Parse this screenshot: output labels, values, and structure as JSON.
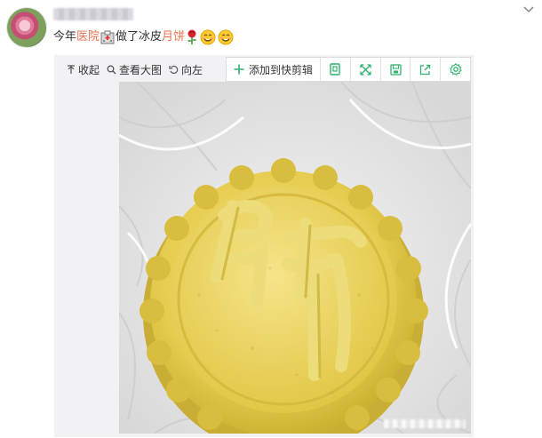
{
  "post": {
    "username": "",
    "text_parts": [
      {
        "type": "text",
        "value": "今年"
      },
      {
        "type": "link",
        "value": "医院"
      },
      {
        "type": "emoji",
        "name": "hospital-emoji"
      },
      {
        "type": "text",
        "value": "做了冰皮"
      },
      {
        "type": "link",
        "value": "月饼"
      },
      {
        "type": "emoji",
        "name": "rose-emoji"
      },
      {
        "type": "emoji",
        "name": "smiley-emoji"
      },
      {
        "type": "emoji",
        "name": "smiley-emoji"
      }
    ]
  },
  "toolbar": {
    "collapse_label": "收起",
    "view_large_label": "查看大图",
    "rotate_left_label": "向左"
  },
  "clipper": {
    "add_label": "添加到快剪辑",
    "buttons": [
      "page-icon",
      "expand-icon",
      "save-icon",
      "share-icon",
      "settings-icon"
    ]
  },
  "image": {
    "subject": "icy-skin mooncake",
    "stamped_text": "月饼"
  },
  "colors": {
    "link": "#eb7350",
    "clipper_accent": "#2fb36d",
    "card_background": "#f2f2f5"
  }
}
